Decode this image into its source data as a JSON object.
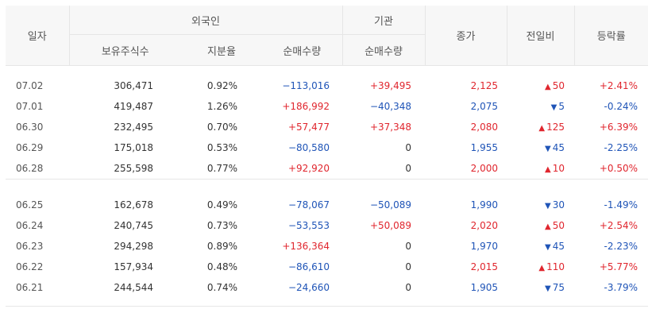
{
  "header": {
    "date": "일자",
    "foreign": "외국인",
    "institution": "기관",
    "close": "종가",
    "change": "전일비",
    "rate": "등락률",
    "holdings": "보유주식수",
    "share_ratio": "지분율",
    "net_buy_foreign": "순매수량",
    "net_buy_inst": "순매수량"
  },
  "colors": {
    "up": "#e0262e",
    "down": "#1f54b7"
  },
  "group1": [
    {
      "date": "07.02",
      "holdings": "306,471",
      "ratio": "0.92%",
      "foreign_net": "−113,016",
      "inst_net": "+39,495",
      "close": "2,125",
      "change": "50",
      "dir": "up",
      "rate": "+2.41%"
    },
    {
      "date": "07.01",
      "holdings": "419,487",
      "ratio": "1.26%",
      "foreign_net": "+186,992",
      "inst_net": "−40,348",
      "close": "2,075",
      "change": "5",
      "dir": "down",
      "rate": "-0.24%"
    },
    {
      "date": "06.30",
      "holdings": "232,495",
      "ratio": "0.70%",
      "foreign_net": "+57,477",
      "inst_net": "+37,348",
      "close": "2,080",
      "change": "125",
      "dir": "up",
      "rate": "+6.39%"
    },
    {
      "date": "06.29",
      "holdings": "175,018",
      "ratio": "0.53%",
      "foreign_net": "−80,580",
      "inst_net": "0",
      "close": "1,955",
      "change": "45",
      "dir": "down",
      "rate": "-2.25%"
    },
    {
      "date": "06.28",
      "holdings": "255,598",
      "ratio": "0.77%",
      "foreign_net": "+92,920",
      "inst_net": "0",
      "close": "2,000",
      "change": "10",
      "dir": "up",
      "rate": "+0.50%"
    }
  ],
  "group2": [
    {
      "date": "06.25",
      "holdings": "162,678",
      "ratio": "0.49%",
      "foreign_net": "−78,067",
      "inst_net": "−50,089",
      "close": "1,990",
      "change": "30",
      "dir": "down",
      "rate": "-1.49%"
    },
    {
      "date": "06.24",
      "holdings": "240,745",
      "ratio": "0.73%",
      "foreign_net": "−53,553",
      "inst_net": "+50,089",
      "close": "2,020",
      "change": "50",
      "dir": "up",
      "rate": "+2.54%"
    },
    {
      "date": "06.23",
      "holdings": "294,298",
      "ratio": "0.89%",
      "foreign_net": "+136,364",
      "inst_net": "0",
      "close": "1,970",
      "change": "45",
      "dir": "down",
      "rate": "-2.23%"
    },
    {
      "date": "06.22",
      "holdings": "157,934",
      "ratio": "0.48%",
      "foreign_net": "−86,610",
      "inst_net": "0",
      "close": "2,015",
      "change": "110",
      "dir": "up",
      "rate": "+5.77%"
    },
    {
      "date": "06.21",
      "holdings": "244,544",
      "ratio": "0.74%",
      "foreign_net": "−24,660",
      "inst_net": "0",
      "close": "1,905",
      "change": "75",
      "dir": "down",
      "rate": "-3.79%"
    }
  ]
}
